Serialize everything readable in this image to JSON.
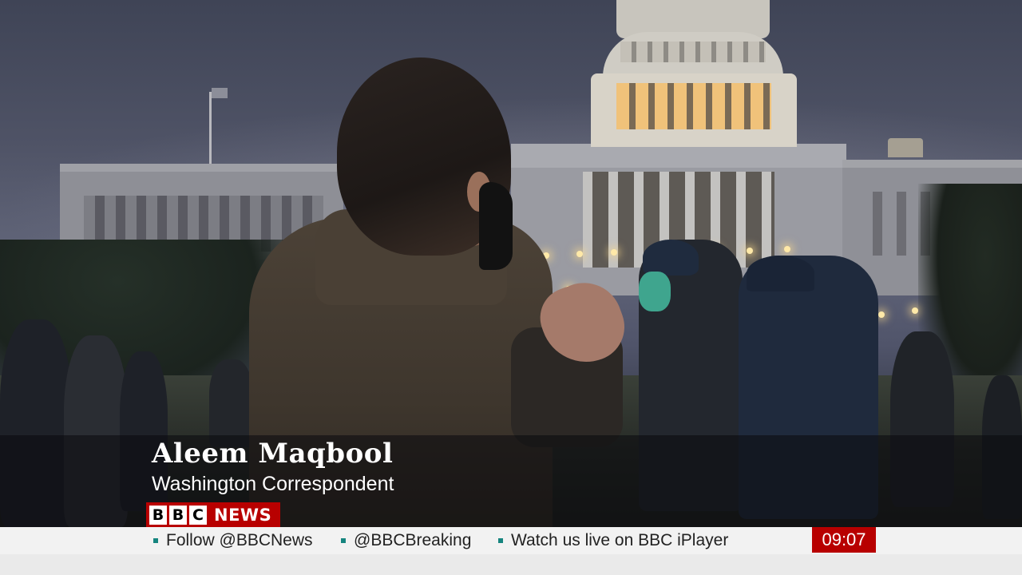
{
  "lower_third": {
    "name": "Aleem Maqbool",
    "title": "Washington Correspondent"
  },
  "logo": {
    "letters": [
      "B",
      "B",
      "C"
    ],
    "word": "NEWS"
  },
  "ticker": {
    "items": [
      "Follow @BBCNews",
      "@BBCBreaking",
      "Watch us live on BBC iPlayer"
    ]
  },
  "clock": "09:07",
  "colors": {
    "brand_red": "#b80000",
    "ticker_bullet": "#16857f",
    "ticker_bg": "#f2f2f2"
  }
}
